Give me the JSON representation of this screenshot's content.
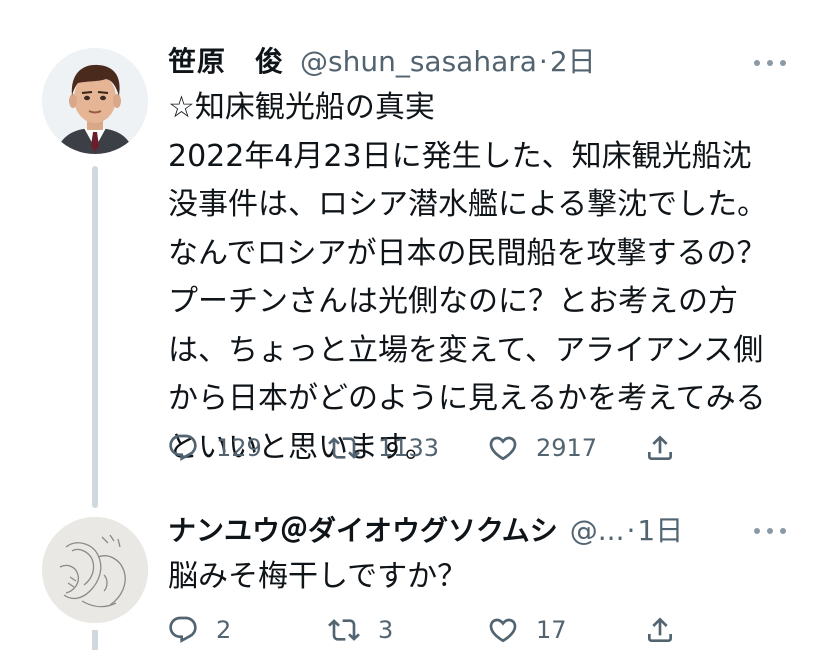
{
  "colors": {
    "text_primary": "#0f1419",
    "text_secondary": "#536471",
    "thread_line": "#cfd9de"
  },
  "tweets": [
    {
      "display_name": "笹原　俊",
      "handle": "@shun_sasahara",
      "separator": "·",
      "time": "2日",
      "more_icon": "more-horizontal-icon",
      "lines": [
        "☆知床観光船の真実",
        "2022年4月23日に発生した、知床観光船沈",
        "没事件は、ロシア潜水艦による撃沈でした。",
        "なんでロシアが日本の民間船を攻撃するの？",
        "プーチンさんは光側なのに？とお考えの方",
        "は、ちょっと立場を変えて、アライアンス側",
        "から日本がどのように見えるかを考えてみる",
        "といいと思います。"
      ],
      "replies": "129",
      "retweets": "1133",
      "likes": "2917"
    },
    {
      "display_name": "ナンユウ＠ダイオウグソクムシ",
      "handle": "@...",
      "separator": "·",
      "time": "1日",
      "more_icon": "more-horizontal-icon",
      "lines": [
        "脳みそ梅干しですか？"
      ],
      "replies": "2",
      "retweets": "3",
      "likes": "17"
    }
  ]
}
